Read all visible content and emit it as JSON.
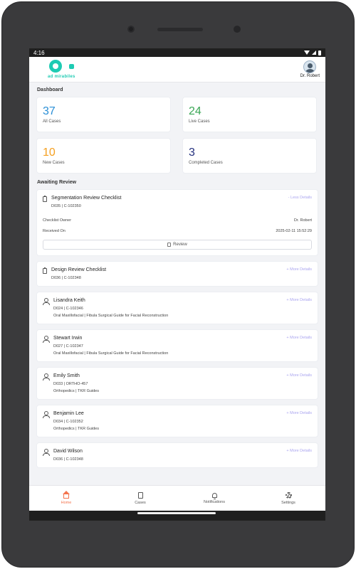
{
  "status_bar": {
    "time": "4:16"
  },
  "app": {
    "logo_text": "ad mirabiles"
  },
  "user": {
    "name": "Dr. Robert"
  },
  "dashboard": {
    "title": "Dashboard",
    "stats": [
      {
        "value": "37",
        "label": "All Cases",
        "color": "#2b8fd6"
      },
      {
        "value": "24",
        "label": "Live Cases",
        "color": "#3aa655"
      },
      {
        "value": "10",
        "label": "New Cases",
        "color": "#f5a020"
      },
      {
        "value": "3",
        "label": "Completed Cases",
        "color": "#24307e"
      }
    ]
  },
  "awaiting": {
    "title": "Awaiting Review",
    "expanded": {
      "title": "Segmentation Review Checklist",
      "sub": "D035 | C-102350",
      "link": "- Less Details",
      "owner_label": "Checklist Owner",
      "owner_value": "Dr. Robert",
      "received_label": "Received On",
      "received_value": "2025-02-11 15:52:29",
      "button": "Review"
    },
    "items": [
      {
        "icon": "document-icon",
        "title": "Design Review Checklist",
        "sub": "D036 | C-102348",
        "sub2": "",
        "link": "+ More Details"
      },
      {
        "icon": "person-icon",
        "title": "Lisandra Keith",
        "sub": "D024 | C-102346",
        "sub2": "Oral Maxillofacial | Fibula Surgical Guide for Facial Reconstruction",
        "link": "+ More Details"
      },
      {
        "icon": "person-icon",
        "title": "Stewart Irwin",
        "sub": "D027 | C-102347",
        "sub2": "Oral Maxillofacial | Fibula Surgical Guide for Facial Reconstruction",
        "link": "+ More Details"
      },
      {
        "icon": "person-icon",
        "title": "Emily Smith",
        "sub": "D033 | ORTHO-457",
        "sub2": "Orthopedics | TKR Guides",
        "link": "+ More Details"
      },
      {
        "icon": "person-icon",
        "title": "Benjamin Lee",
        "sub": "D034 | C-102352",
        "sub2": "Orthopedics | TKR Guides",
        "link": "+ More Details"
      },
      {
        "icon": "person-icon",
        "title": "David Wilson",
        "sub": "D036 | C-102348",
        "sub2": "",
        "link": "+ More Details"
      }
    ]
  },
  "nav": [
    {
      "label": "Home",
      "icon": "home-icon",
      "active": true
    },
    {
      "label": "Cases",
      "icon": "cases-icon",
      "active": false
    },
    {
      "label": "Notifications",
      "icon": "bell-icon",
      "active": false
    },
    {
      "label": "Settings",
      "icon": "gear-icon",
      "active": false
    }
  ],
  "colors": {
    "accent": "#1ecbb3",
    "nav_active": "#f4744e",
    "link": "#a9a4ef"
  }
}
